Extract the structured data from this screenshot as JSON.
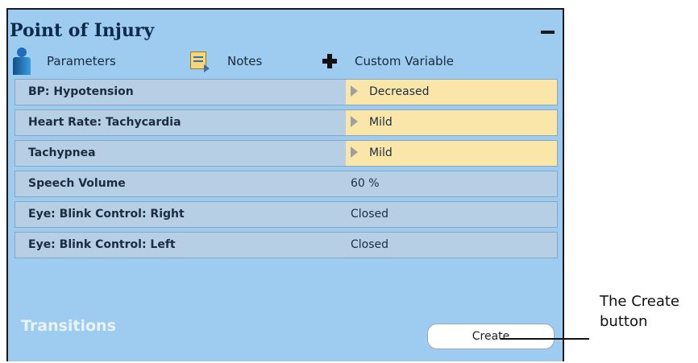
{
  "panel": {
    "title": "Point of Injury",
    "collapse_symbol": "−"
  },
  "tabs": [
    {
      "label": "Parameters",
      "icon": "person-icon"
    },
    {
      "label": "Notes",
      "icon": "notes-icon"
    },
    {
      "label": "Custom Variable",
      "icon": "plus-icon"
    }
  ],
  "rows": [
    {
      "label": "BP: Hypotension",
      "value": "Decreased",
      "highlighted": true
    },
    {
      "label": "Heart Rate: Tachycardia",
      "value": "Mild",
      "highlighted": true
    },
    {
      "label": "Tachypnea",
      "value": "Mild",
      "highlighted": true
    },
    {
      "label": "Speech Volume",
      "value": "60 %",
      "highlighted": false
    },
    {
      "label": "Eye: Blink Control: Right",
      "value": "Closed",
      "highlighted": false
    },
    {
      "label": "Eye: Blink Control: Left",
      "value": "Closed",
      "highlighted": false
    }
  ],
  "footer": {
    "transitions_label": "Transitions",
    "create_label": "Create"
  },
  "annotation": {
    "line1": "The Create",
    "line2": "button"
  },
  "colors": {
    "panel_bg": "#9ecbf0",
    "row_bg": "#b6cfe5",
    "highlight_bg": "#fbe6a9"
  }
}
